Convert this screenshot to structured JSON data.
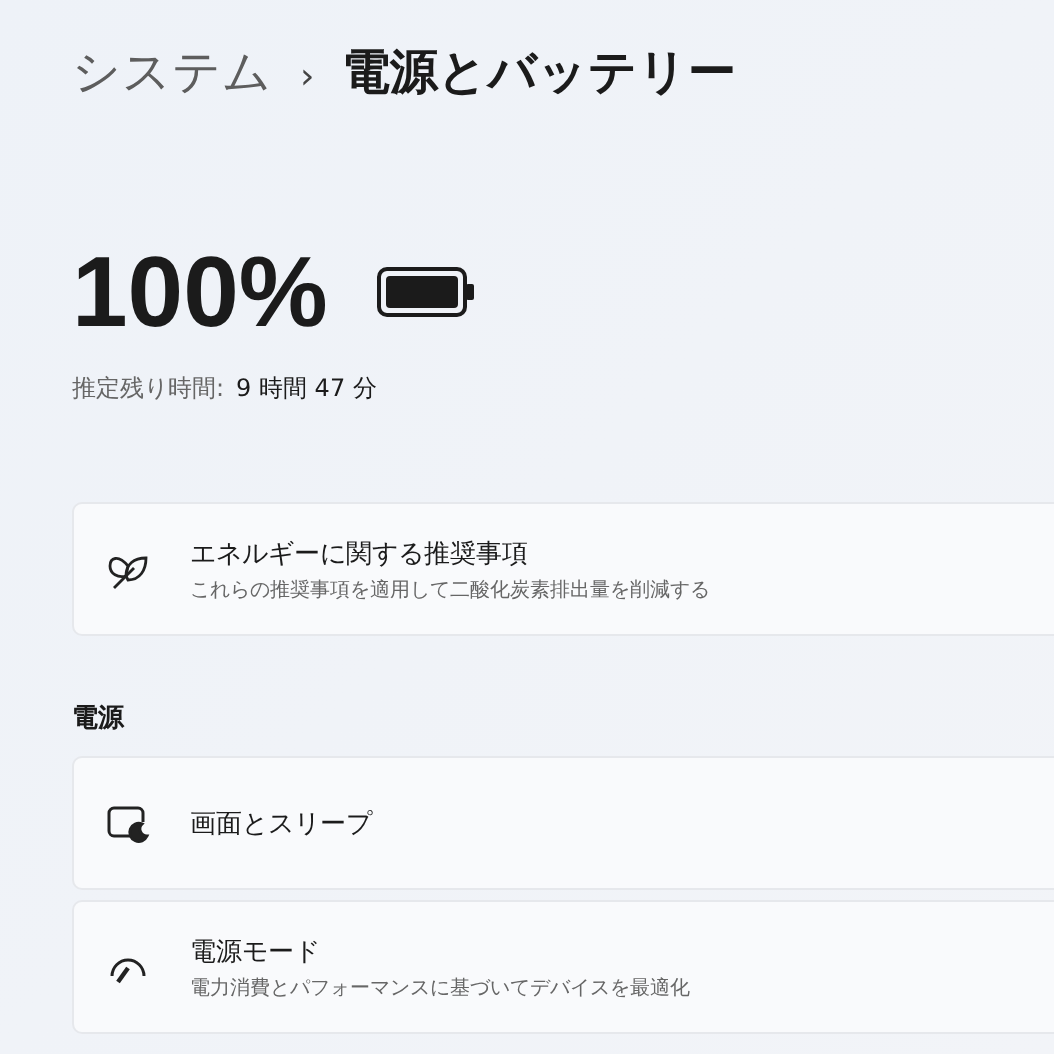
{
  "breadcrumb": {
    "parent": "システム",
    "separator": "›",
    "current": "電源とバッテリー"
  },
  "battery": {
    "percent": "100%",
    "estimate_label": "推定残り時間:",
    "estimate_value": "9 時間 47 分"
  },
  "recommendations": [
    {
      "title": "エネルギーに関する推奨事項",
      "subtitle": "これらの推奨事項を適用して二酸化炭素排出量を削減する"
    }
  ],
  "power_section": {
    "heading": "電源",
    "items": [
      {
        "title": "画面とスリープ"
      },
      {
        "title": "電源モード",
        "subtitle": "電力消費とパフォーマンスに基づいてデバイスを最適化"
      }
    ]
  }
}
